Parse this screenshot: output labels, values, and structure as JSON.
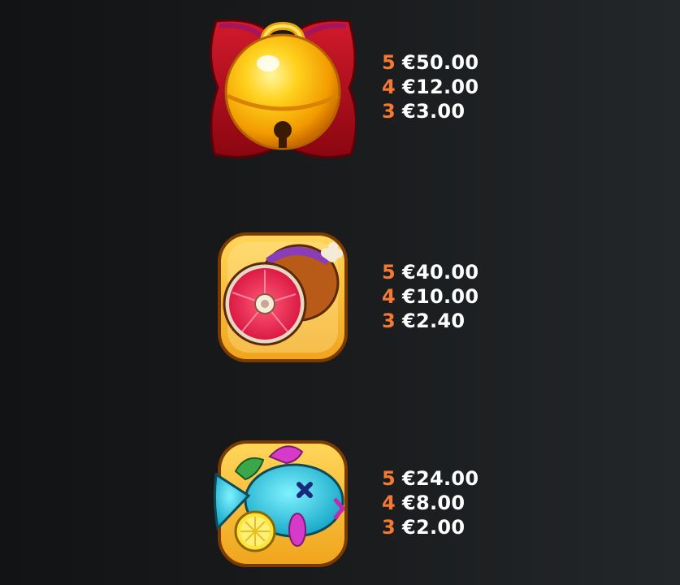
{
  "paytable": [
    {
      "symbol": "bell-icon",
      "payouts": [
        {
          "count": "5",
          "amount": "€50.00"
        },
        {
          "count": "4",
          "amount": "€12.00"
        },
        {
          "count": "3",
          "amount": "€3.00"
        }
      ]
    },
    {
      "symbol": "ham-icon",
      "payouts": [
        {
          "count": "5",
          "amount": "€40.00"
        },
        {
          "count": "4",
          "amount": "€10.00"
        },
        {
          "count": "3",
          "amount": "€2.40"
        }
      ]
    },
    {
      "symbol": "fish-icon",
      "payouts": [
        {
          "count": "5",
          "amount": "€24.00"
        },
        {
          "count": "4",
          "amount": "€8.00"
        },
        {
          "count": "3",
          "amount": "€2.00"
        }
      ]
    }
  ],
  "colors": {
    "count": "#f47a33",
    "amount": "#ffffff",
    "background": "#1a1c1e"
  }
}
